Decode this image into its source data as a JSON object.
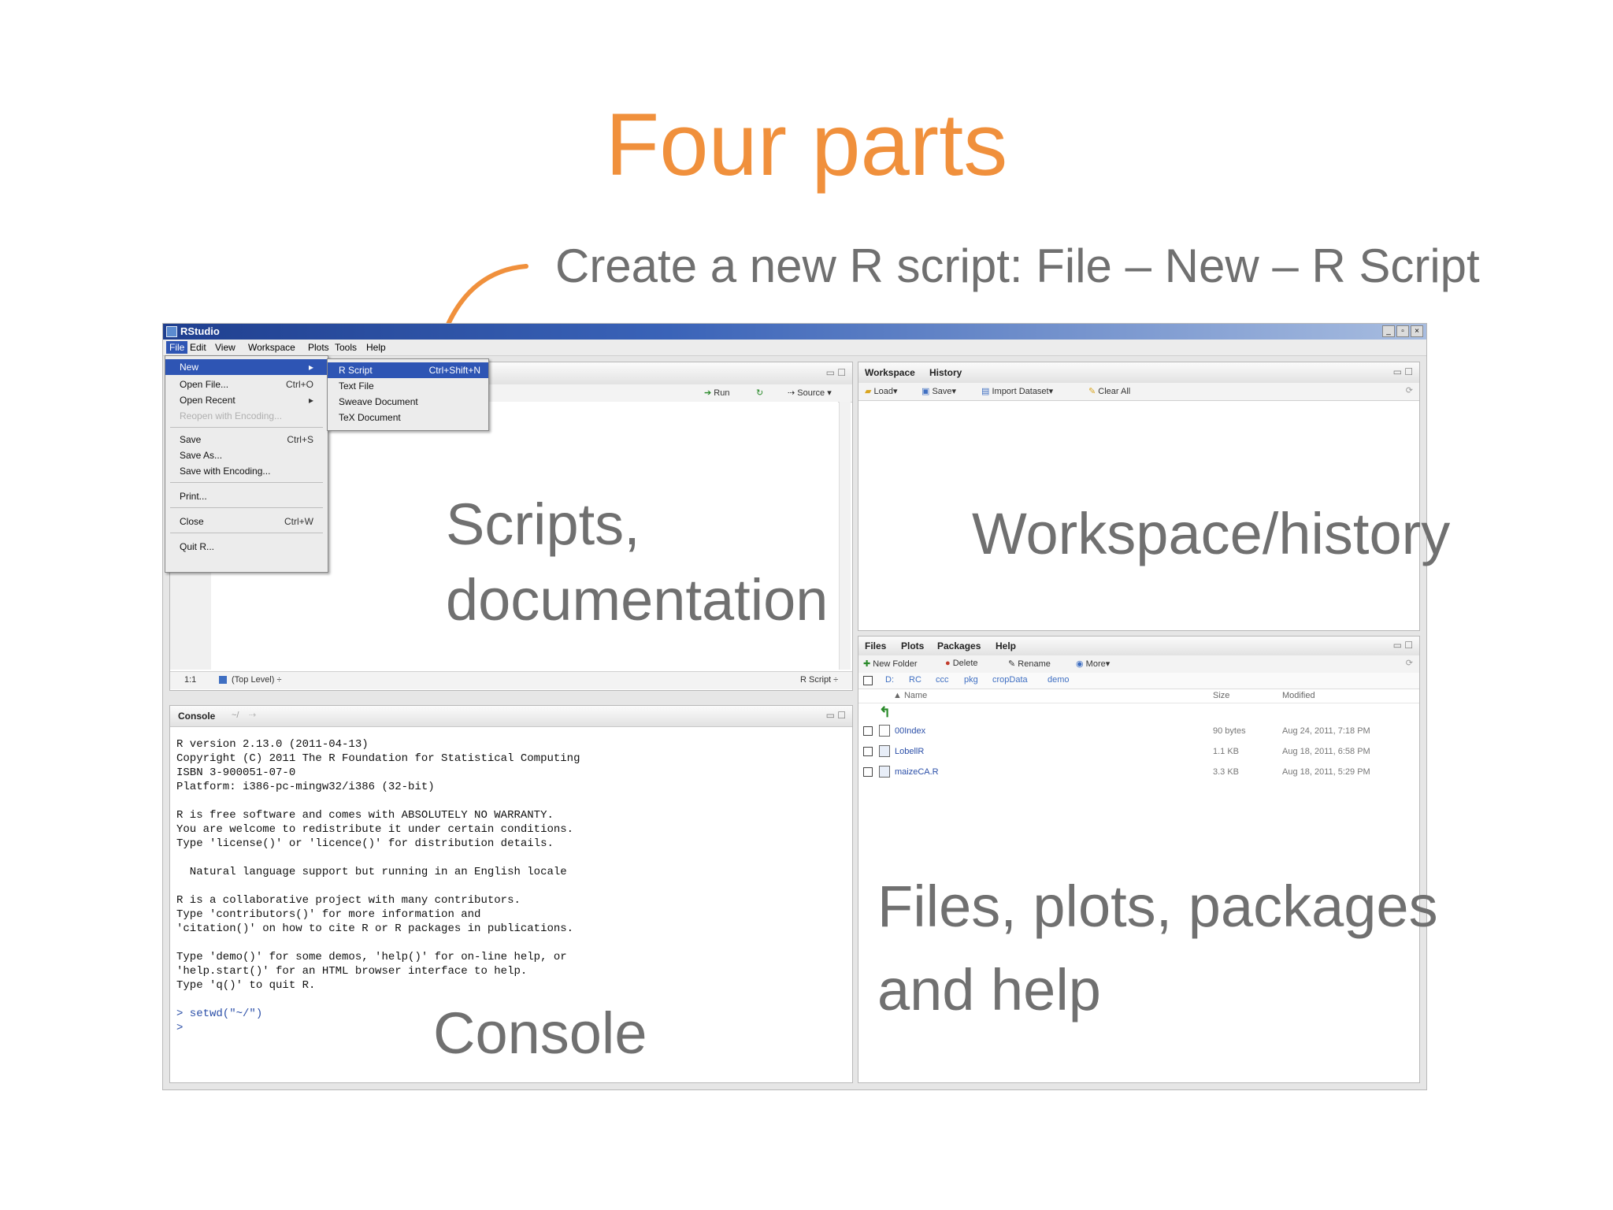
{
  "slide": {
    "title": "Four parts",
    "subtitle": "Create a new R script: File – New – R Script"
  },
  "labels": {
    "scripts_line1": "Scripts,",
    "scripts_line2": "documentation",
    "workspace": "Workspace/history",
    "files_line1": "Files, plots, packages",
    "files_line2": "and help",
    "console": "Console"
  },
  "window": {
    "title": "RStudio",
    "menu": [
      "File",
      "Edit",
      "View",
      "Workspace",
      "Plots",
      "Tools",
      "Help"
    ],
    "controls": [
      "_",
      "▫",
      "×"
    ]
  },
  "file_menu": {
    "items": [
      {
        "label": "New",
        "shortcut": "▸"
      },
      {
        "label": "Open File...",
        "shortcut": "Ctrl+O"
      },
      {
        "label": "Open Recent",
        "shortcut": "▸"
      },
      {
        "label": "Reopen with Encoding...",
        "shortcut": ""
      },
      {
        "label": "Save",
        "shortcut": "Ctrl+S"
      },
      {
        "label": "Save As...",
        "shortcut": ""
      },
      {
        "label": "Save with Encoding...",
        "shortcut": ""
      },
      {
        "label": "Print...",
        "shortcut": ""
      },
      {
        "label": "Close",
        "shortcut": "Ctrl+W"
      },
      {
        "label": "Quit R...",
        "shortcut": ""
      }
    ]
  },
  "new_submenu": {
    "items": [
      {
        "label": "R Script",
        "shortcut": "Ctrl+Shift+N"
      },
      {
        "label": "Text File",
        "shortcut": ""
      },
      {
        "label": "Sweave Document",
        "shortcut": ""
      },
      {
        "label": "TeX Document",
        "shortcut": ""
      }
    ]
  },
  "editor": {
    "run": "Run",
    "source": "Source",
    "status_pos": "1:1",
    "status_level": "(Top Level) ÷",
    "status_type": "R Script ÷"
  },
  "workspace_pane": {
    "tabs": [
      "Workspace",
      "History"
    ],
    "toolbar": [
      "Load▾",
      "Save▾",
      "Import Dataset▾",
      "Clear All"
    ]
  },
  "files_pane": {
    "tabs": [
      "Files",
      "Plots",
      "Packages",
      "Help"
    ],
    "toolbar": [
      "New Folder",
      "Delete",
      "Rename",
      "More▾"
    ],
    "breadcrumb": [
      "D:",
      "RC",
      "ccc",
      "pkg",
      "cropData",
      "demo"
    ],
    "columns": [
      "▲ Name",
      "Size",
      "Modified"
    ],
    "rows": [
      {
        "name": "00Index",
        "size": "90 bytes",
        "modified": "Aug 24, 2011, 7:18 PM"
      },
      {
        "name": "LobellR",
        "size": "1.1 KB",
        "modified": "Aug 18, 2011, 6:58 PM"
      },
      {
        "name": "maizeCA.R",
        "size": "3.3 KB",
        "modified": "Aug 18, 2011, 5:29 PM"
      }
    ]
  },
  "console_pane": {
    "tab": "Console",
    "path": "~/",
    "lines": [
      "R version 2.13.0 (2011-04-13)",
      "Copyright (C) 2011 The R Foundation for Statistical Computing",
      "ISBN 3-900051-07-0",
      "Platform: i386-pc-mingw32/i386 (32-bit)",
      "",
      "R is free software and comes with ABSOLUTELY NO WARRANTY.",
      "You are welcome to redistribute it under certain conditions.",
      "Type 'license()' or 'licence()' for distribution details.",
      "",
      "  Natural language support but running in an English locale",
      "",
      "R is a collaborative project with many contributors.",
      "Type 'contributors()' for more information and",
      "'citation()' on how to cite R or R packages in publications.",
      "",
      "Type 'demo()' for some demos, 'help()' for on-line help, or",
      "'help.start()' for an HTML browser interface to help.",
      "Type 'q()' to quit R.",
      ""
    ],
    "command": "> setwd(\"~/\")",
    "prompt": ">"
  }
}
